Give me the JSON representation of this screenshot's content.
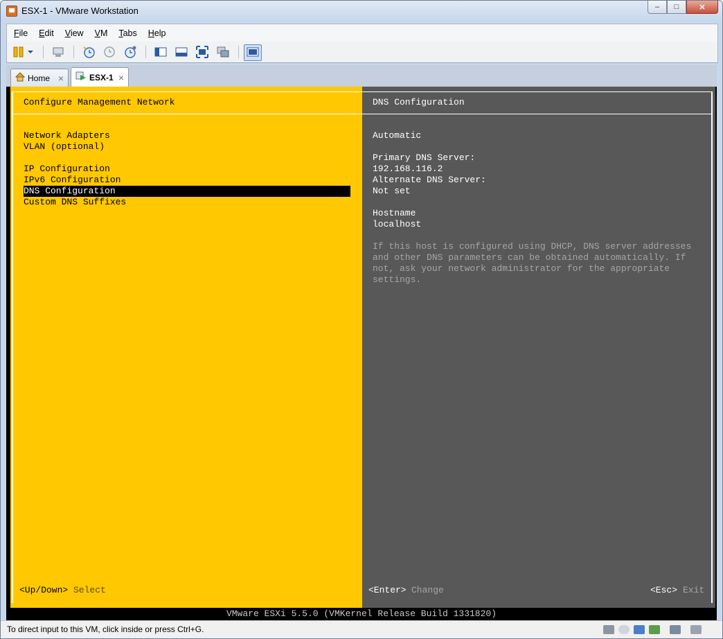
{
  "window": {
    "title": "ESX-1 - VMware Workstation",
    "minimize": "–",
    "maximize": "□",
    "close": "✕"
  },
  "menubar": [
    "File",
    "Edit",
    "View",
    "VM",
    "Tabs",
    "Help"
  ],
  "tabs": [
    {
      "label": "Home",
      "close": "×"
    },
    {
      "label": "ESX-1",
      "close": "×"
    }
  ],
  "console": {
    "left": {
      "title": "Configure Management Network",
      "items": [
        "Network Adapters",
        "VLAN (optional)",
        "IP Configuration",
        "IPv6 Configuration",
        "DNS Configuration",
        "Custom DNS Suffixes"
      ],
      "selected": "DNS Configuration",
      "hint_key": "<Up/Down>",
      "hint_action": "Select"
    },
    "right": {
      "title": "DNS Configuration",
      "mode": "Automatic",
      "primary_label": "Primary DNS Server:",
      "primary_value": "192.168.116.2",
      "alternate_label": "Alternate DNS Server:",
      "alternate_value": "Not set",
      "hostname_label": "Hostname",
      "hostname_value": "localhost",
      "help_lines": [
        "If this host is configured using DHCP, DNS server addresses",
        "and other DNS parameters can be obtained automatically. If",
        "not, ask your network administrator for the appropriate",
        "settings."
      ],
      "enter_key": "<Enter>",
      "enter_action": "Change",
      "esc_key": "<Esc>",
      "esc_action": "Exit"
    },
    "footer": "VMware ESXi 5.5.0 (VMKernel Release Build 1331820)"
  },
  "statusbar": {
    "text": "To direct input to this VM, click inside or press Ctrl+G."
  },
  "colors": {
    "esxi_yellow": "#ffc800",
    "esxi_gray": "#585858",
    "selection": "#000000"
  }
}
